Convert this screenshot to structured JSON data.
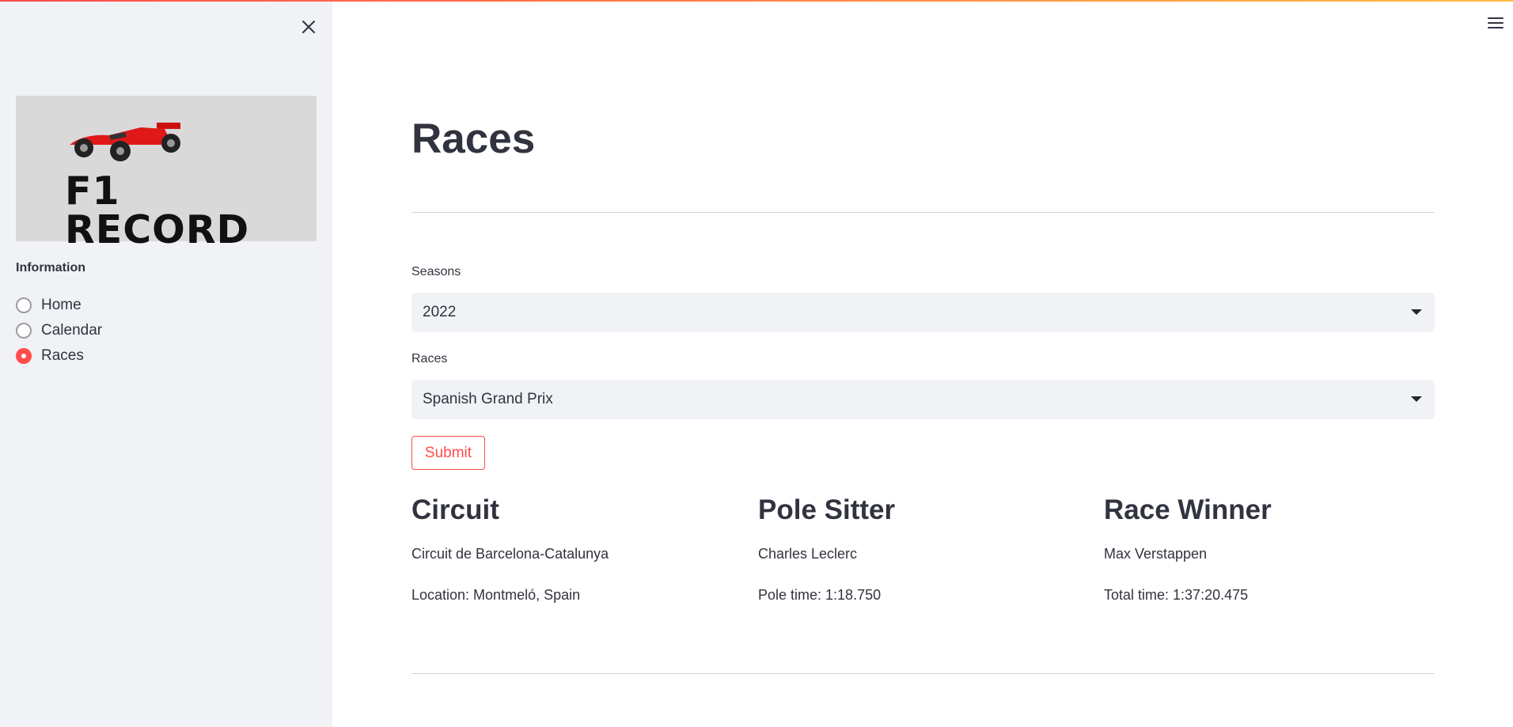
{
  "sidebar": {
    "logo_text": "F1 RECORD",
    "nav_label": "Information",
    "items": [
      {
        "label": "Home",
        "selected": false
      },
      {
        "label": "Calendar",
        "selected": false
      },
      {
        "label": "Races",
        "selected": true
      }
    ]
  },
  "main": {
    "title": "Races",
    "seasons_label": "Seasons",
    "seasons_value": "2022",
    "races_label": "Races",
    "races_value": "Spanish Grand Prix",
    "submit_label": "Submit",
    "columns": [
      {
        "heading": "Circuit",
        "line1": "Circuit de Barcelona-Catalunya",
        "line2": "Location: Montmeló, Spain"
      },
      {
        "heading": "Pole Sitter",
        "line1": "Charles Leclerc",
        "line2": "Pole time: 1:18.750"
      },
      {
        "heading": "Race Winner",
        "line1": "Max Verstappen",
        "line2": "Total time: 1:37:20.475"
      }
    ]
  },
  "colors": {
    "accent": "#ff4b4b",
    "sidebar_bg": "#f0f2f6",
    "text": "#31333f"
  },
  "icons": {
    "close": "close-icon",
    "menu": "hamburger-menu-icon",
    "caret": "chevron-down-icon"
  }
}
